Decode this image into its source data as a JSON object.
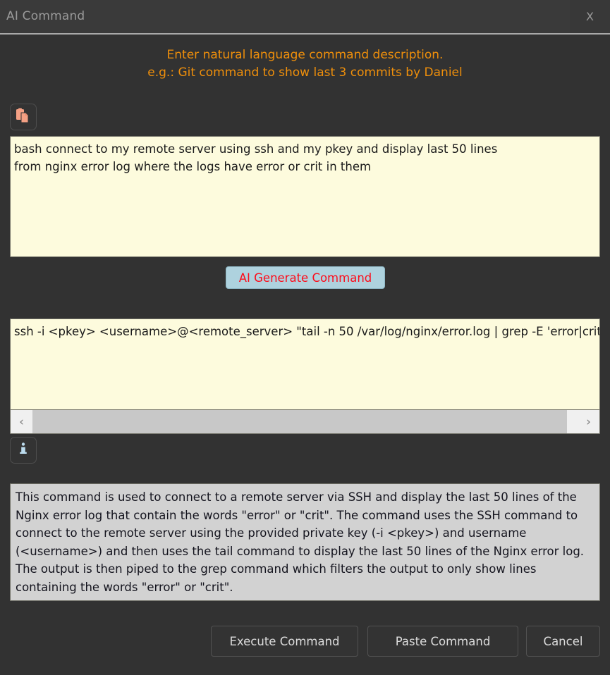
{
  "window": {
    "title": "AI Command",
    "close_label": "X",
    "close_icon": "close-x-icon"
  },
  "instructions": {
    "line1": "Enter natural language command description.",
    "line2": "e.g.: Git command to show last 3 commits by Daniel",
    "color": "#ef8f0b"
  },
  "toolbar": {
    "paste_icon": "clipboard-paste-icon",
    "paste_icon_color": "#f4a084",
    "info_icon": "info-icon",
    "info_icon_color": "#bcdcee"
  },
  "nl_input": {
    "value": "bash connect to my remote server using ssh and my pkey and display last 50 lines\nfrom nginx error log where the logs have error or crit in them",
    "placeholder": "Enter natural language command description.",
    "background": "#fdfbdd"
  },
  "generate": {
    "label": "AI Generate Command",
    "background": "#aed2de",
    "text_color": "#fc0d1b"
  },
  "command_output": {
    "value": "ssh -i <pkey> <username>@<remote_server> \"tail -n 50 /var/log/nginx/error.log | grep -E 'error|crit'\"",
    "background": "#fdfbdd"
  },
  "scrollbar": {
    "left_arrow": "‹",
    "right_arrow": "›",
    "left_icon": "chevron-left-icon",
    "right_icon": "chevron-right-icon"
  },
  "description": {
    "text": "This command is used to connect to a remote server via SSH and display the last 50 lines of the Nginx error log that contain the words \"error\" or \"crit\". The command uses the SSH command to connect to the remote server using the provided private key (-i <pkey>) and username (<username>) and then uses the tail command to display the last 50 lines of the Nginx error log. The output is then piped to the grep command which filters the output to only show lines containing the words \"error\" or \"crit\".",
    "background": "#d2d2d2"
  },
  "footer": {
    "execute_label": "Execute Command",
    "paste_label": "Paste Command",
    "cancel_label": "Cancel"
  }
}
